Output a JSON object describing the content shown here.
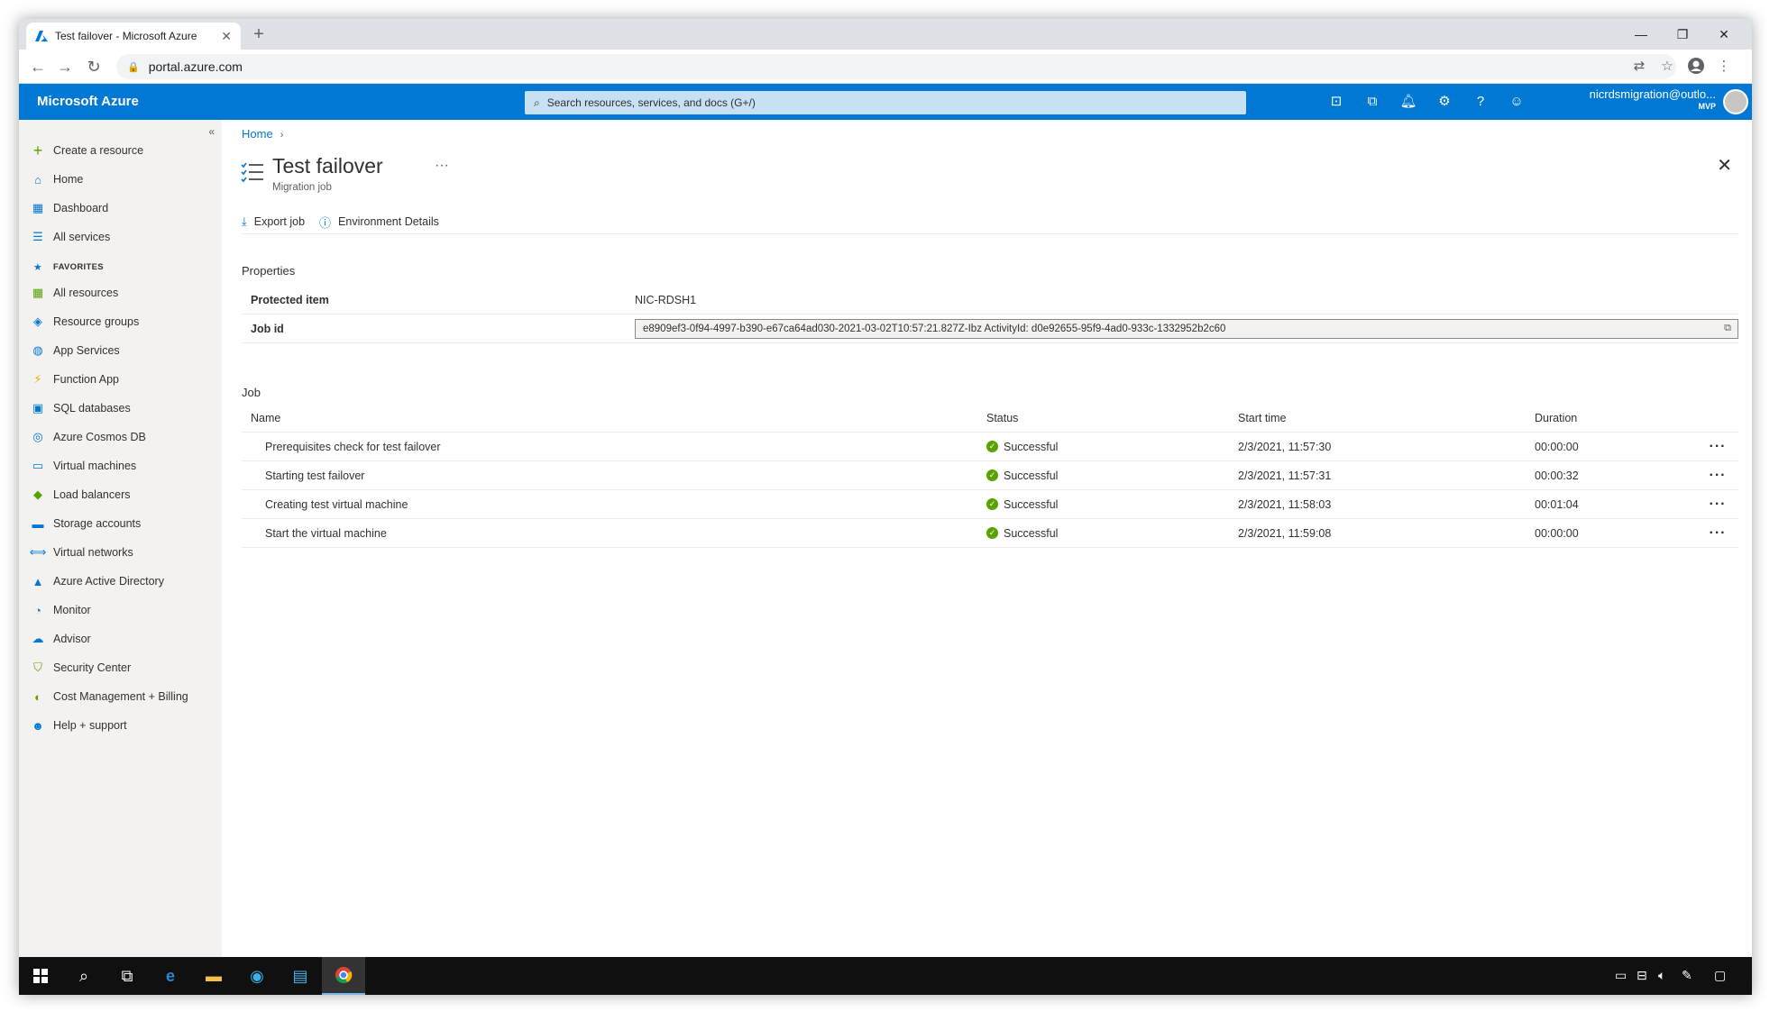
{
  "browser": {
    "tab_title": "Test failover - Microsoft Azure",
    "tab_close": "✕",
    "new_tab": "+",
    "url": "portal.azure.com",
    "window_controls": {
      "minimize": "—",
      "maximize": "❐",
      "close": "✕"
    }
  },
  "azure_header": {
    "brand": "Microsoft Azure",
    "search_placeholder": "Search resources, services, and docs (G+/)",
    "user_email": "nicrdsmigration@outlo...",
    "user_badge": "MVP"
  },
  "sidebar": {
    "create": "Create a resource",
    "home": "Home",
    "dashboard": "Dashboard",
    "all_services": "All services",
    "favorites_header": "FAVORITES",
    "favorites": [
      {
        "label": "All resources",
        "icon": "grid-icon",
        "color": "#57a300"
      },
      {
        "label": "Resource groups",
        "icon": "cube-icon",
        "color": "#0078d4"
      },
      {
        "label": "App Services",
        "icon": "globe-icon",
        "color": "#0078d4"
      },
      {
        "label": "Function App",
        "icon": "bolt-icon",
        "color": "#f2a900"
      },
      {
        "label": "SQL databases",
        "icon": "database-icon",
        "color": "#0078d4"
      },
      {
        "label": "Azure Cosmos DB",
        "icon": "planet-icon",
        "color": "#0078d4"
      },
      {
        "label": "Virtual machines",
        "icon": "monitor-icon",
        "color": "#0078d4"
      },
      {
        "label": "Load balancers",
        "icon": "diamond-icon",
        "color": "#57a300"
      },
      {
        "label": "Storage accounts",
        "icon": "storage-icon",
        "color": "#0078d4"
      },
      {
        "label": "Virtual networks",
        "icon": "network-icon",
        "color": "#0078d4"
      },
      {
        "label": "Azure Active Directory",
        "icon": "pyramid-icon",
        "color": "#0078d4"
      },
      {
        "label": "Monitor",
        "icon": "gauge-icon",
        "color": "#0078d4"
      },
      {
        "label": "Advisor",
        "icon": "cloud-icon",
        "color": "#0078d4"
      },
      {
        "label": "Security Center",
        "icon": "shield-icon",
        "color": "#57a300"
      },
      {
        "label": "Cost Management + Billing",
        "icon": "coin-icon",
        "color": "#57a300"
      },
      {
        "label": "Help + support",
        "icon": "person-icon",
        "color": "#0078d4"
      }
    ]
  },
  "main": {
    "breadcrumb_home": "Home",
    "title": "Test failover",
    "title_more": "···",
    "subtitle": "Migration job",
    "toolbar": {
      "export": "Export job",
      "env": "Environment Details"
    },
    "properties_label": "Properties",
    "properties": {
      "protected_key": "Protected item",
      "protected_val": "NIC-RDSH1",
      "jobid_key": "Job id",
      "jobid_val": "e8909ef3-0f94-4997-b390-e67ca64ad030-2021-03-02T10:57:21.827Z-Ibz ActivityId: d0e92655-95f9-4ad0-933c-1332952b2c60"
    },
    "job_label": "Job",
    "job_table": {
      "headers": [
        "Name",
        "Status",
        "Start time",
        "Duration"
      ],
      "rows": [
        {
          "name": "Prerequisites check for test failover",
          "status": "Successful",
          "start": "2/3/2021, 11:57:30",
          "duration": "00:00:00"
        },
        {
          "name": "Starting test failover",
          "status": "Successful",
          "start": "2/3/2021, 11:57:31",
          "duration": "00:00:32"
        },
        {
          "name": "Creating test virtual machine",
          "status": "Successful",
          "start": "2/3/2021, 11:58:03",
          "duration": "00:01:04"
        },
        {
          "name": "Start the virtual machine",
          "status": "Successful",
          "start": "2/3/2021, 11:59:08",
          "duration": "00:00:00"
        }
      ],
      "row_more": "···"
    }
  },
  "colors": {
    "azure_blue": "#0078d4",
    "success_green": "#57a300",
    "taskbar": "#101010"
  }
}
